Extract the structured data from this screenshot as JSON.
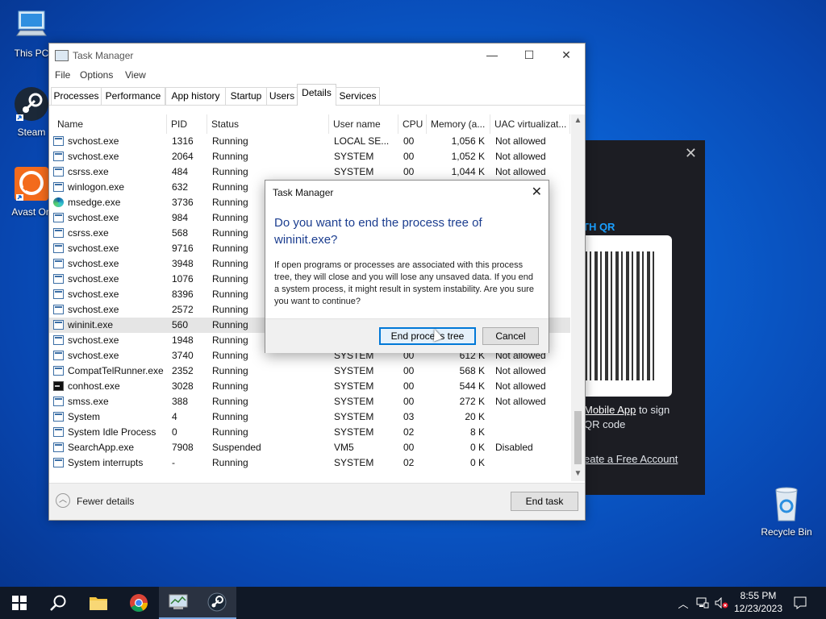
{
  "desktop": {
    "icons": [
      {
        "label": "This PC",
        "icon": "computer-icon"
      },
      {
        "label": "Steam",
        "icon": "steam-icon"
      },
      {
        "label": "Avast On",
        "icon": "avast-icon"
      },
      {
        "label": "Recycle Bin",
        "icon": "recycle-bin-icon"
      }
    ]
  },
  "background_app": {
    "qr_title": "TH QR",
    "mobile_link": "Mobile App",
    "mobile_suffix": " to sign",
    "qr_line2": "QR code",
    "create_account": "eate a Free Account"
  },
  "task_manager": {
    "title": "Task Manager",
    "menu": [
      "File",
      "Options",
      "View"
    ],
    "tabs": [
      "Processes",
      "Performance",
      "App history",
      "Startup",
      "Users",
      "Details",
      "Services"
    ],
    "active_tab": "Details",
    "columns": [
      "Name",
      "PID",
      "Status",
      "User name",
      "CPU",
      "Memory (a...",
      "UAC virtualizat..."
    ],
    "rows": [
      [
        "svchost.exe",
        "1316",
        "Running",
        "LOCAL SE...",
        "00",
        "1,056 K",
        "Not allowed"
      ],
      [
        "svchost.exe",
        "2064",
        "Running",
        "SYSTEM",
        "00",
        "1,052 K",
        "Not allowed"
      ],
      [
        "csrss.exe",
        "484",
        "Running",
        "SYSTEM",
        "00",
        "1,044 K",
        "Not allowed"
      ],
      [
        "winlogon.exe",
        "632",
        "Running",
        "",
        "",
        "",
        ""
      ],
      [
        "msedge.exe",
        "3736",
        "Running",
        "",
        "",
        "",
        ""
      ],
      [
        "svchost.exe",
        "984",
        "Running",
        "",
        "",
        "",
        ""
      ],
      [
        "csrss.exe",
        "568",
        "Running",
        "",
        "",
        "",
        ""
      ],
      [
        "svchost.exe",
        "9716",
        "Running",
        "",
        "",
        "",
        ""
      ],
      [
        "svchost.exe",
        "3948",
        "Running",
        "",
        "",
        "",
        ""
      ],
      [
        "svchost.exe",
        "1076",
        "Running",
        "",
        "",
        "",
        ""
      ],
      [
        "svchost.exe",
        "8396",
        "Running",
        "",
        "",
        "",
        ""
      ],
      [
        "svchost.exe",
        "2572",
        "Running",
        "",
        "",
        "",
        ""
      ],
      [
        "wininit.exe",
        "560",
        "Running",
        "",
        "",
        "",
        ""
      ],
      [
        "svchost.exe",
        "1948",
        "Running",
        "",
        "",
        "",
        ""
      ],
      [
        "svchost.exe",
        "3740",
        "Running",
        "SYSTEM",
        "00",
        "612 K",
        "Not allowed"
      ],
      [
        "CompatTelRunner.exe",
        "2352",
        "Running",
        "SYSTEM",
        "00",
        "568 K",
        "Not allowed"
      ],
      [
        "conhost.exe",
        "3028",
        "Running",
        "SYSTEM",
        "00",
        "544 K",
        "Not allowed"
      ],
      [
        "smss.exe",
        "388",
        "Running",
        "SYSTEM",
        "00",
        "272 K",
        "Not allowed"
      ],
      [
        "System",
        "4",
        "Running",
        "SYSTEM",
        "03",
        "20 K",
        ""
      ],
      [
        "System Idle Process",
        "0",
        "Running",
        "SYSTEM",
        "02",
        "8 K",
        ""
      ],
      [
        "SearchApp.exe",
        "7908",
        "Suspended",
        "VM5",
        "00",
        "0 K",
        "Disabled"
      ],
      [
        "System interrupts",
        "-",
        "Running",
        "SYSTEM",
        "02",
        "0 K",
        ""
      ]
    ],
    "row_icons": [
      "app",
      "app",
      "app",
      "app",
      "edge",
      "app",
      "app",
      "app",
      "app",
      "app",
      "app",
      "app",
      "app",
      "app",
      "app",
      "app",
      "con",
      "app",
      "app",
      "app",
      "app",
      "app"
    ],
    "selected_row": 12,
    "fewer_details": "Fewer details",
    "end_task": "End task"
  },
  "dialog": {
    "title": "Task Manager",
    "heading": "Do you want to end the process tree of wininit.exe?",
    "body": "If open programs or processes are associated with this process tree, they will close and you will lose any unsaved data. If you end a system process, it might result in system instability. Are you sure you want to continue?",
    "primary": "End process tree",
    "cancel": "Cancel"
  },
  "taskbar": {
    "time": "8:55 PM",
    "date": "12/23/2023"
  }
}
